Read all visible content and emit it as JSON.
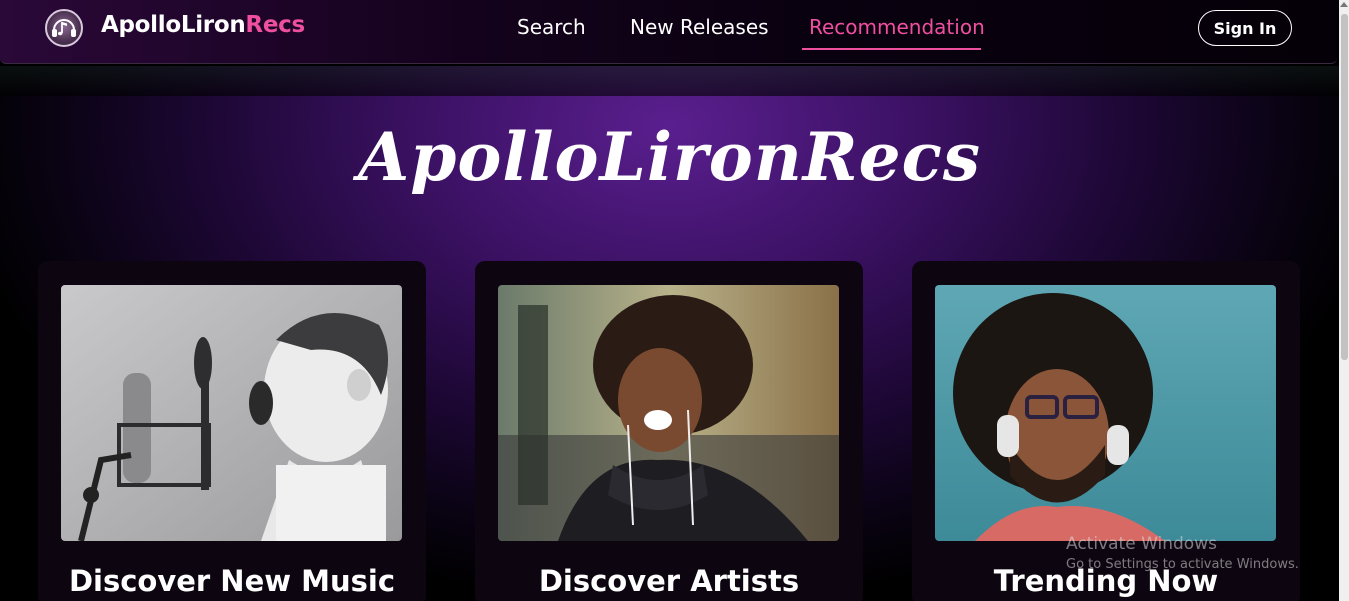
{
  "nav": {
    "brand_main": "ApolloLiron",
    "brand_accent": "Recs",
    "links": [
      {
        "label": "Search"
      },
      {
        "label": "New Releases"
      },
      {
        "label": "Recommendation"
      }
    ],
    "active_link": "Recommendation",
    "signin_label": "Sign In",
    "logo_icon": "headphones-music-note-icon"
  },
  "hero": {
    "title": "ApolloLironRecs"
  },
  "cards": [
    {
      "title": "Discover New Music",
      "image": "boy-singing-into-microphone-photo"
    },
    {
      "title": "Discover Artists",
      "image": "woman-with-earphones-singing-photo"
    },
    {
      "title": "Trending Now",
      "image": "man-with-headphones-photo"
    }
  ],
  "watermark": {
    "title": "Activate Windows",
    "subtitle": "Go to Settings to activate Windows."
  },
  "colors": {
    "accent": "#ef4f9f",
    "hero_purple": "#5a1f8f",
    "card_bg": "#0d0611",
    "nav_bg": "#2a0838"
  }
}
